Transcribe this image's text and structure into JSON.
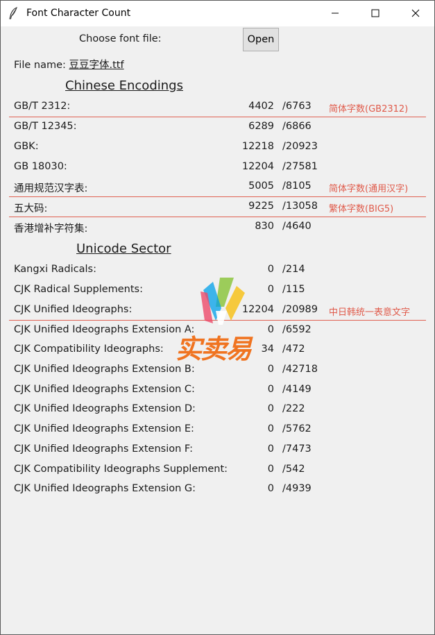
{
  "window": {
    "title": "Font Character Count",
    "icon": "feather-icon",
    "controls": [
      "minimize-icon",
      "maximize-icon",
      "close-icon"
    ]
  },
  "file": {
    "choose_label": "Choose font file:",
    "open_button": "Open",
    "name_label": "File name: ",
    "name_value": "豆豆字体.ttf"
  },
  "chinese": {
    "title": "Chinese Encodings",
    "rows": [
      {
        "name": "GB/T 2312:",
        "count": "4402",
        "total": "/6763",
        "note": "简体字数(GB2312)"
      },
      {
        "name": "GB/T 12345:",
        "count": "6289",
        "total": "/6866",
        "note": ""
      },
      {
        "name": "GBK:",
        "count": "12218",
        "total": "/20923",
        "note": ""
      },
      {
        "name": "GB 18030:",
        "count": "12204",
        "total": "/27581",
        "note": ""
      },
      {
        "name": "通用规范汉字表:",
        "count": "5005",
        "total": "/8105",
        "note": "简体字数(通用汉字)"
      },
      {
        "name": "五大码:",
        "count": "9225",
        "total": "/13058",
        "note": "繁体字数(BIG5)"
      },
      {
        "name": "香港增补字符集:",
        "count": "830",
        "total": "/4640",
        "note": ""
      }
    ]
  },
  "unicode": {
    "title": "Unicode Sector",
    "rows": [
      {
        "name": "Kangxi Radicals:",
        "count": "0",
        "total": "/214",
        "note": ""
      },
      {
        "name": "CJK Radical Supplements:",
        "count": "0",
        "total": "/115",
        "note": ""
      },
      {
        "name": "CJK Unified Ideographs:",
        "count": "12204",
        "total": "/20989",
        "note": "中日韩统一表意文字"
      },
      {
        "name": "CJK Unified Ideographs Extension A:",
        "count": "0",
        "total": "/6592",
        "note": ""
      },
      {
        "name": "CJK Compatibility Ideographs:",
        "count": "34",
        "total": "/472",
        "note": ""
      },
      {
        "name": "CJK Unified Ideographs Extension B:",
        "count": "0",
        "total": "/42718",
        "note": ""
      },
      {
        "name": "CJK Unified Ideographs Extension C:",
        "count": "0",
        "total": "/4149",
        "note": ""
      },
      {
        "name": "CJK Unified Ideographs Extension D:",
        "count": "0",
        "total": "/222",
        "note": ""
      },
      {
        "name": "CJK Unified Ideographs Extension E:",
        "count": "0",
        "total": "/5762",
        "note": ""
      },
      {
        "name": "CJK Unified Ideographs Extension F:",
        "count": "0",
        "total": "/7473",
        "note": ""
      },
      {
        "name": "CJK Compatibility Ideographs Supplement:",
        "count": "0",
        "total": "/542",
        "note": ""
      },
      {
        "name": "CJK Unified Ideographs Extension G:",
        "count": "0",
        "total": "/4939",
        "note": ""
      }
    ]
  },
  "watermark": {
    "text": "实卖易",
    "colors": [
      "#f7941d",
      "#8dc63f",
      "#ed1c24",
      "#00a0e9"
    ]
  },
  "colors": {
    "note": "#e05a4a",
    "separator": "#e06050",
    "background": "#f0f0f0"
  }
}
